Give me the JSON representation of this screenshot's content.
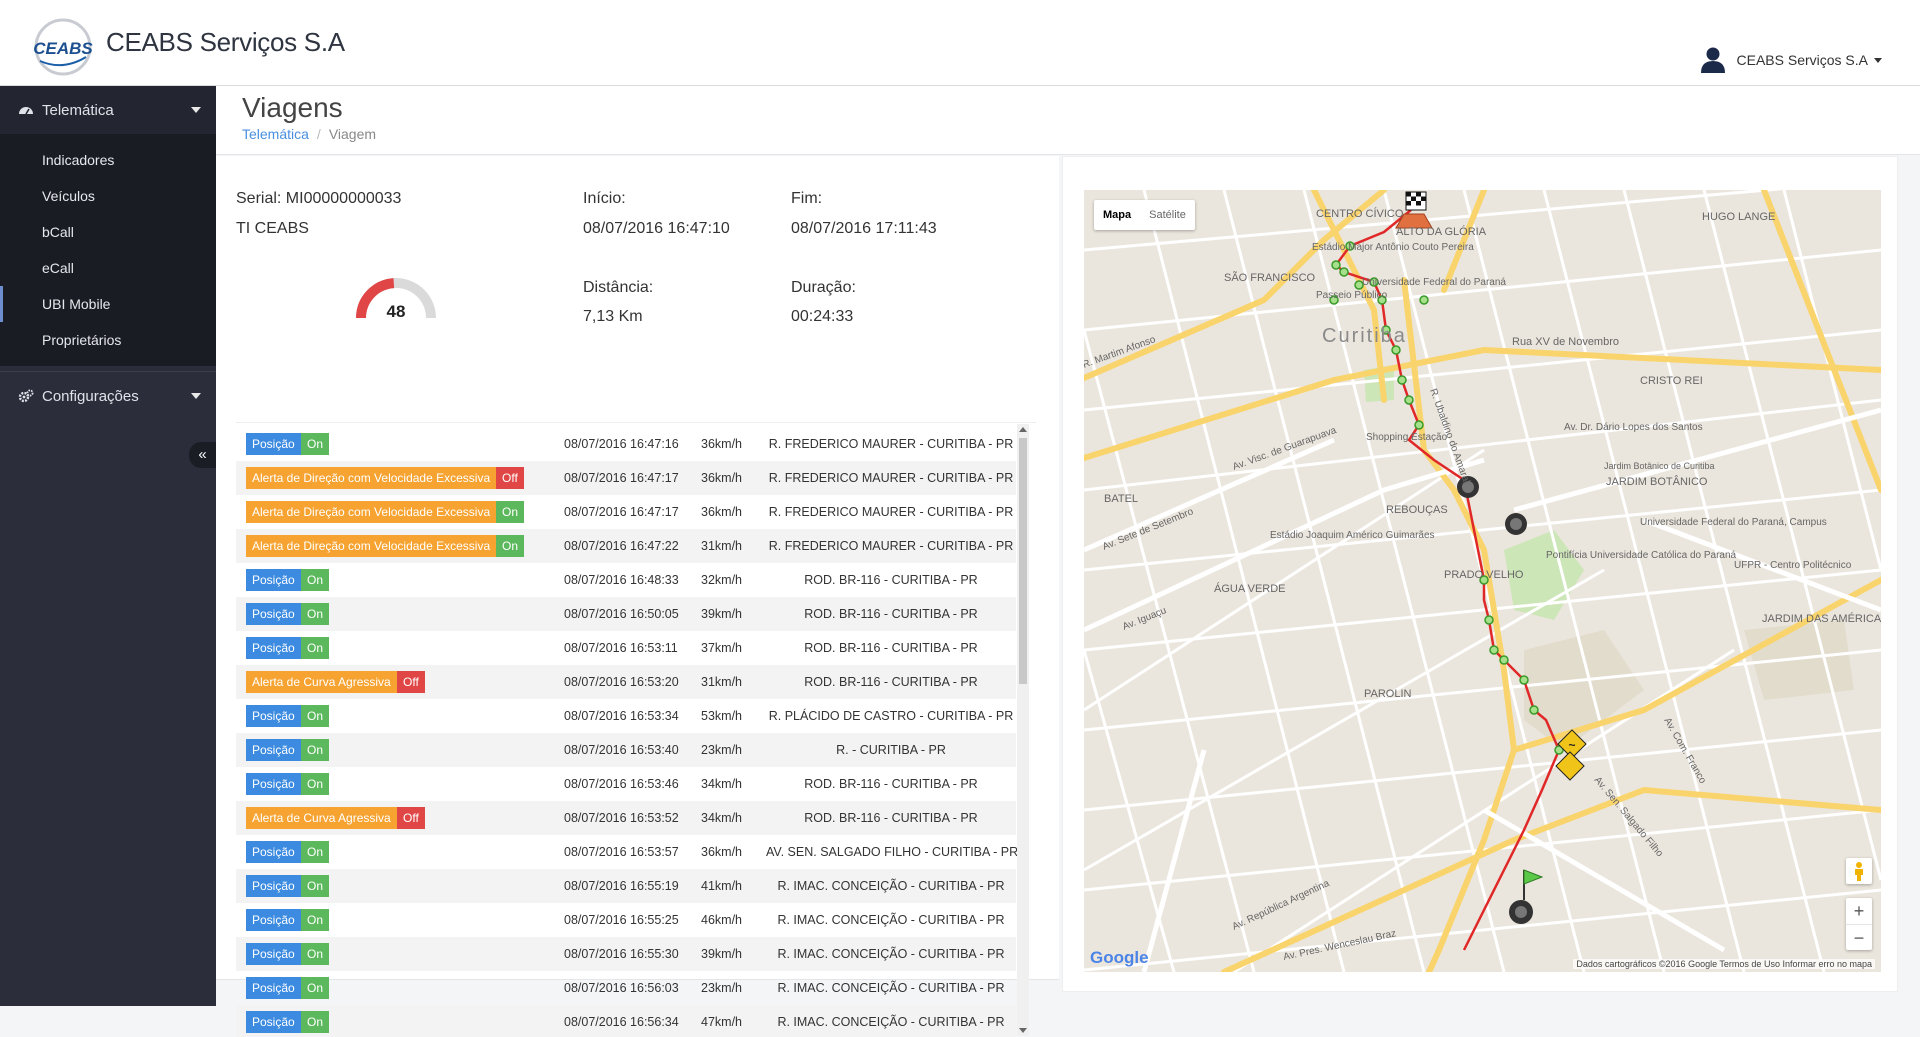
{
  "header": {
    "brand": "CEABS Serviços S.A",
    "logo_text": "CEABS",
    "user_name": "CEABS Serviços S.A"
  },
  "sidebar": {
    "sections": [
      {
        "label": "Telemática",
        "icon": "dashboard-icon"
      },
      {
        "label": "Configurações",
        "icon": "gears-icon"
      }
    ],
    "items": [
      {
        "label": "Indicadores"
      },
      {
        "label": "Veículos"
      },
      {
        "label": "bCall"
      },
      {
        "label": "eCall"
      },
      {
        "label": "UBI Mobile"
      },
      {
        "label": "Proprietários"
      }
    ],
    "active_item": "UBI Mobile",
    "collapse_glyph": "«"
  },
  "page": {
    "title": "Viagens",
    "breadcrumb": [
      "Telemática",
      "Viagem"
    ]
  },
  "trip": {
    "serial_label": "Serial: MI00000000033",
    "driver": "TI CEABS",
    "start_label": "Início:",
    "start_value": "08/07/2016 16:47:10",
    "end_label": "Fim:",
    "end_value": "08/07/2016 17:11:43",
    "distance_label": "Distância:",
    "distance_value": "7,13 Km",
    "duration_label": "Duração:",
    "duration_value": "00:24:33",
    "score": "48",
    "score_fraction": 0.48
  },
  "events": [
    {
      "type": "Posição",
      "state": "On",
      "time": "08/07/2016 16:47:16",
      "speed": "36km/h",
      "address": "R. FREDERICO MAURER - CURITIBA - PR"
    },
    {
      "type": "Alerta de Direção com Velocidade Excessiva",
      "state": "Off",
      "time": "08/07/2016 16:47:17",
      "speed": "36km/h",
      "address": "R. FREDERICO MAURER - CURITIBA - PR"
    },
    {
      "type": "Alerta de Direção com Velocidade Excessiva",
      "state": "On",
      "time": "08/07/2016 16:47:17",
      "speed": "36km/h",
      "address": "R. FREDERICO MAURER - CURITIBA - PR"
    },
    {
      "type": "Alerta de Direção com Velocidade Excessiva",
      "state": "On",
      "time": "08/07/2016 16:47:22",
      "speed": "31km/h",
      "address": "R. FREDERICO MAURER - CURITIBA - PR"
    },
    {
      "type": "Posição",
      "state": "On",
      "time": "08/07/2016 16:48:33",
      "speed": "32km/h",
      "address": "ROD. BR-116 - CURITIBA - PR"
    },
    {
      "type": "Posição",
      "state": "On",
      "time": "08/07/2016 16:50:05",
      "speed": "39km/h",
      "address": "ROD. BR-116 - CURITIBA - PR"
    },
    {
      "type": "Posição",
      "state": "On",
      "time": "08/07/2016 16:53:11",
      "speed": "37km/h",
      "address": "ROD. BR-116 - CURITIBA - PR"
    },
    {
      "type": "Alerta de Curva Agressiva",
      "state": "Off",
      "time": "08/07/2016 16:53:20",
      "speed": "31km/h",
      "address": "ROD. BR-116 - CURITIBA - PR"
    },
    {
      "type": "Posição",
      "state": "On",
      "time": "08/07/2016 16:53:34",
      "speed": "53km/h",
      "address": "R. PLÁCIDO DE CASTRO - CURITIBA - PR"
    },
    {
      "type": "Posição",
      "state": "On",
      "time": "08/07/2016 16:53:40",
      "speed": "23km/h",
      "address": "R. - CURITIBA - PR"
    },
    {
      "type": "Posição",
      "state": "On",
      "time": "08/07/2016 16:53:46",
      "speed": "34km/h",
      "address": "ROD. BR-116 - CURITIBA - PR"
    },
    {
      "type": "Alerta de Curva Agressiva",
      "state": "Off",
      "time": "08/07/2016 16:53:52",
      "speed": "34km/h",
      "address": "ROD. BR-116 - CURITIBA - PR"
    },
    {
      "type": "Posição",
      "state": "On",
      "time": "08/07/2016 16:53:57",
      "speed": "36km/h",
      "address": "AV. SEN. SALGADO FILHO - CURITIBA - PR"
    },
    {
      "type": "Posição",
      "state": "On",
      "time": "08/07/2016 16:55:19",
      "speed": "41km/h",
      "address": "R. IMAC. CONCEIÇÃO - CURITIBA - PR"
    },
    {
      "type": "Posição",
      "state": "On",
      "time": "08/07/2016 16:55:25",
      "speed": "46km/h",
      "address": "R. IMAC. CONCEIÇÃO - CURITIBA - PR"
    },
    {
      "type": "Posição",
      "state": "On",
      "time": "08/07/2016 16:55:30",
      "speed": "39km/h",
      "address": "R. IMAC. CONCEIÇÃO - CURITIBA - PR"
    },
    {
      "type": "Posição",
      "state": "On",
      "time": "08/07/2016 16:56:03",
      "speed": "23km/h",
      "address": "R. IMAC. CONCEIÇÃO - CURITIBA - PR"
    },
    {
      "type": "Posição",
      "state": "On",
      "time": "08/07/2016 16:56:34",
      "speed": "47km/h",
      "address": "R. IMAC. CONCEIÇÃO - CURITIBA - PR"
    }
  ],
  "map": {
    "type_buttons": [
      "Mapa",
      "Satélite"
    ],
    "active_type": "Mapa",
    "zoom_in": "+",
    "zoom_out": "−",
    "attribution": "Dados cartográficos ©2016 Google   Termos de Uso   Informar erro no mapa",
    "google": "Google",
    "labels": [
      "CENTRO CÍVICO",
      "ALTO DA GLÓRIA",
      "HUGO LANGE",
      "SÃO FRANCISCO",
      "Curitiba",
      "Rua XV de Novembro",
      "CRISTO REI",
      "Av. Dr. Dário Lopes dos Santos",
      "Shopping Estação",
      "JARDIM BOTÂNICO",
      "Jardim Botânico de Curitiba",
      "REBOUÇAS",
      "BATEL",
      "Estádio Joaquim Américo Guimarães",
      "Universidade Federal do Paraná, Campus",
      "UFPR - Centro Politécnico",
      "PRADO VELHO",
      "Pontifícia Universidade Católica do Paraná",
      "ÁGUA VERDE",
      "PAROLIN",
      "JARDIM DAS AMÉRICAS",
      "Estádio Major Antônio Couto Pereira",
      "Universidade Federal do Paraná",
      "Passeio Público",
      "Av. Sete de Setembro",
      "Av. Iguaçu",
      "Av. República Argentina",
      "Av. Pres. Wenceslau Braz",
      "Av. Sen. Salgado Filho",
      "Av. Com. Franco",
      "R. Martim Afonso",
      "R. Ubaldino do Amaral",
      "Av. Visc. de Guarapuava"
    ]
  },
  "colors": {
    "sidebar_bg": "#2b2e3a",
    "accent_blue": "#3c8be0",
    "warning": "#f6a331",
    "success": "#5cb85c",
    "danger": "#e04646",
    "route": "#e02828"
  }
}
